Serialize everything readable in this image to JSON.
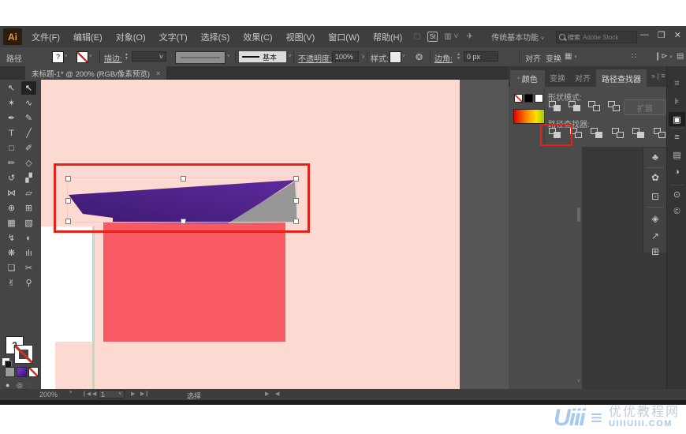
{
  "menu_bar": {
    "logo": "Ai",
    "items": [
      "文件(F)",
      "编辑(E)",
      "对象(O)",
      "文字(T)",
      "选择(S)",
      "效果(C)",
      "视图(V)",
      "窗口(W)",
      "帮助(H)"
    ],
    "stock_badge": "St",
    "workspace": "传统基本功能",
    "search_label": "搜索",
    "search_brand": "Adobe Stock",
    "window_controls": {
      "minimize": "—",
      "restore": "❐",
      "close": "✕"
    }
  },
  "control_bar": {
    "target_label": "路径",
    "fill_value": "?",
    "stroke_label": "描边:",
    "brush_name": "基本",
    "opacity_label": "不透明度:",
    "opacity_value": "100%",
    "more_arrow": "›",
    "style_label": "样式:",
    "corner_label": "边角:",
    "corner_value": "0 px",
    "align_label": "对齐",
    "transform_label": "变换"
  },
  "document_tab": {
    "title": "未标题-1* @ 200% (RGB/像素预览)",
    "close_label": "×"
  },
  "toolbar": {
    "tools": [
      {
        "name": "selection-tool",
        "glyph": "↖",
        "selected": false
      },
      {
        "name": "direct-selection-tool",
        "glyph": "↖",
        "selected": true
      },
      {
        "name": "magic-wand-tool",
        "glyph": "✶",
        "selected": false
      },
      {
        "name": "lasso-tool",
        "glyph": "∿",
        "selected": false
      },
      {
        "name": "pen-tool",
        "glyph": "✒",
        "selected": false
      },
      {
        "name": "curvature-tool",
        "glyph": "✎",
        "selected": false
      },
      {
        "name": "type-tool",
        "glyph": "T",
        "selected": false
      },
      {
        "name": "line-segment-tool",
        "glyph": "╱",
        "selected": false
      },
      {
        "name": "rectangle-tool",
        "glyph": "□",
        "selected": false
      },
      {
        "name": "paintbrush-tool",
        "glyph": "✐",
        "selected": false
      },
      {
        "name": "pencil-tool",
        "glyph": "✏",
        "selected": false
      },
      {
        "name": "shaper-tool",
        "glyph": "◇",
        "selected": false
      },
      {
        "name": "rotate-tool",
        "glyph": "↺",
        "selected": false
      },
      {
        "name": "scale-tool",
        "glyph": "▞",
        "selected": false
      },
      {
        "name": "width-tool",
        "glyph": "⋈",
        "selected": false
      },
      {
        "name": "free-transform-tool",
        "glyph": "▱",
        "selected": false
      },
      {
        "name": "shape-builder-tool",
        "glyph": "⊕",
        "selected": false
      },
      {
        "name": "perspective-grid-tool",
        "glyph": "⊞",
        "selected": false
      },
      {
        "name": "mesh-tool",
        "glyph": "▦",
        "selected": false
      },
      {
        "name": "gradient-tool",
        "glyph": "▧",
        "selected": false
      },
      {
        "name": "eyedropper-tool",
        "glyph": "↯",
        "selected": false
      },
      {
        "name": "blend-tool",
        "glyph": "◐",
        "selected": false
      },
      {
        "name": "symbol-sprayer-tool",
        "glyph": "❋",
        "selected": false
      },
      {
        "name": "graph-tool",
        "glyph": "ılı",
        "selected": false
      },
      {
        "name": "artboard-tool",
        "glyph": "❏",
        "selected": false
      },
      {
        "name": "slice-tool",
        "glyph": "✂",
        "selected": false
      },
      {
        "name": "hand-tool",
        "glyph": "✌",
        "selected": false
      },
      {
        "name": "zoom-tool",
        "glyph": "⚲",
        "selected": false
      }
    ]
  },
  "canvas": {
    "artboard_color": "#fcd9d1",
    "pasteboard_color": "#565656",
    "white_shape_color": "#ffffff",
    "red_rect_color": "#f75a63",
    "teal_line_color": "#b7dcc9",
    "purple_gradient_from": "#3c1a70",
    "purple_gradient_to": "#5e2a9e",
    "gray_triangle_color": "#979797",
    "annotation_color": "#e7211a",
    "selection_color": "#d6d6d6"
  },
  "panels": {
    "color_tab": "颜色",
    "group_tabs": [
      "变换",
      "对齐"
    ],
    "active_tab": "路径查找器",
    "overflow_label": "» | ≡",
    "pathfinder": {
      "shape_modes_label": "形状模式:",
      "shape_mode_icons": [
        "unite",
        "minus-front",
        "intersect",
        "exclude"
      ],
      "expand_button": "扩展",
      "pathfinders_label": "路径查找器:",
      "pathfinder_icons": [
        "divide",
        "trim",
        "merge",
        "crop",
        "outline",
        "minus-back"
      ],
      "highlighted_icon": "divide"
    },
    "dock_strip_icons": [
      {
        "name": "symbols-panel-icon",
        "glyph": "♣"
      },
      {
        "name": "brushes-panel-icon",
        "glyph": "✿"
      },
      {
        "name": "links-panel-icon",
        "glyph": "⊡"
      },
      {
        "name": "layers-panel-icon",
        "glyph": "◈"
      },
      {
        "name": "export-panel-icon",
        "glyph": "↗"
      },
      {
        "name": "artboards-panel-icon",
        "glyph": "⊞"
      }
    ],
    "right_strip_icons": [
      {
        "name": "transform-panel-icon",
        "glyph": "⌗",
        "active": false
      },
      {
        "name": "align-panel-icon",
        "glyph": "⊧",
        "active": false
      },
      {
        "name": "pathfinder-panel-icon",
        "glyph": "▣",
        "active": true
      },
      {
        "name": "stroke-panel-icon",
        "glyph": "≡",
        "active": false
      },
      {
        "name": "gradient-panel-icon",
        "glyph": "▤",
        "active": false
      },
      {
        "name": "transparency-panel-icon",
        "glyph": "◑",
        "active": false
      },
      {
        "name": "appearance-panel-icon",
        "glyph": "⊙",
        "active": false
      },
      {
        "name": "cc-libraries-panel-icon",
        "glyph": "©",
        "active": false
      }
    ]
  },
  "status_bar": {
    "zoom": "200%",
    "artboard_number": "1",
    "tool_status": "选择"
  },
  "watermark": {
    "logo": "Uiii",
    "site_name": "优优教程网",
    "site_url": "UIIIUIII.COM"
  }
}
